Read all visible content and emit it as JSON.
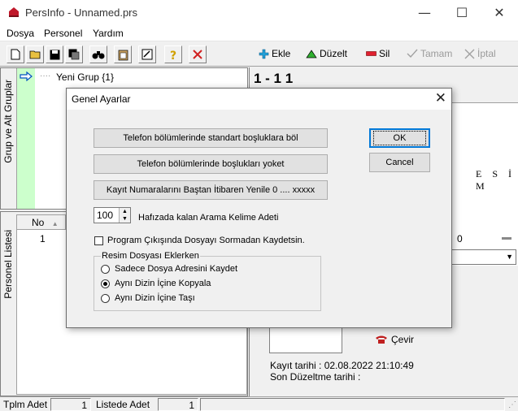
{
  "window": {
    "title": "PersInfo - Unnamed.prs",
    "minimize": "—",
    "maximize": "☐",
    "close": "✕"
  },
  "menu": [
    "Dosya",
    "Personel",
    "Yardım"
  ],
  "toolbar": {
    "add": "Ekle",
    "edit": "Düzelt",
    "delete": "Sil",
    "ok": "Tamam",
    "cancel": "İptal"
  },
  "left": {
    "group_label": "Grup ve Alt Gruplar",
    "tree_node": "Yeni Grup  {1}",
    "personnel_label": "Personel Listesi",
    "list_header": "No",
    "list_cell": "1"
  },
  "right": {
    "record_number": "1 - 1 1",
    "spaced_text": "E S İ M",
    "zero": "0",
    "dial": "Çevir",
    "registered": "Kayıt tarihi : 02.08.2022  21:10:49",
    "last_edit": "Son Düzeltme tarihi :"
  },
  "status": {
    "total_label": "Tplm Adet",
    "total_value": "1",
    "listed_label": "Listede Adet",
    "listed_value": "1"
  },
  "dialog": {
    "title": "Genel Ayarlar",
    "btn_split": "Telefon bölümlerinde standart boşluklara böl",
    "btn_remove": "Telefon bölümlerinde boşlukları yoket",
    "btn_renumber": "Kayıt Numaralarını Baştan İtibaren Yenile 0 .... xxxxx",
    "ok": "OK",
    "cancel": "Cancel",
    "spin_value": "100",
    "spin_label": "Hafızada kalan Arama Kelime Adeti",
    "checkbox_label": "Program Çıkışında Dosyayı Sormadan Kaydetsin.",
    "checkbox_checked": false,
    "group_title": "Resim Dosyası Eklerken",
    "radios": [
      {
        "label": "Sadece Dosya Adresini Kaydet",
        "selected": false
      },
      {
        "label": "Aynı Dizin İçine Kopyala",
        "selected": true
      },
      {
        "label": "Aynı Dizin İçine Taşı",
        "selected": false
      }
    ]
  }
}
